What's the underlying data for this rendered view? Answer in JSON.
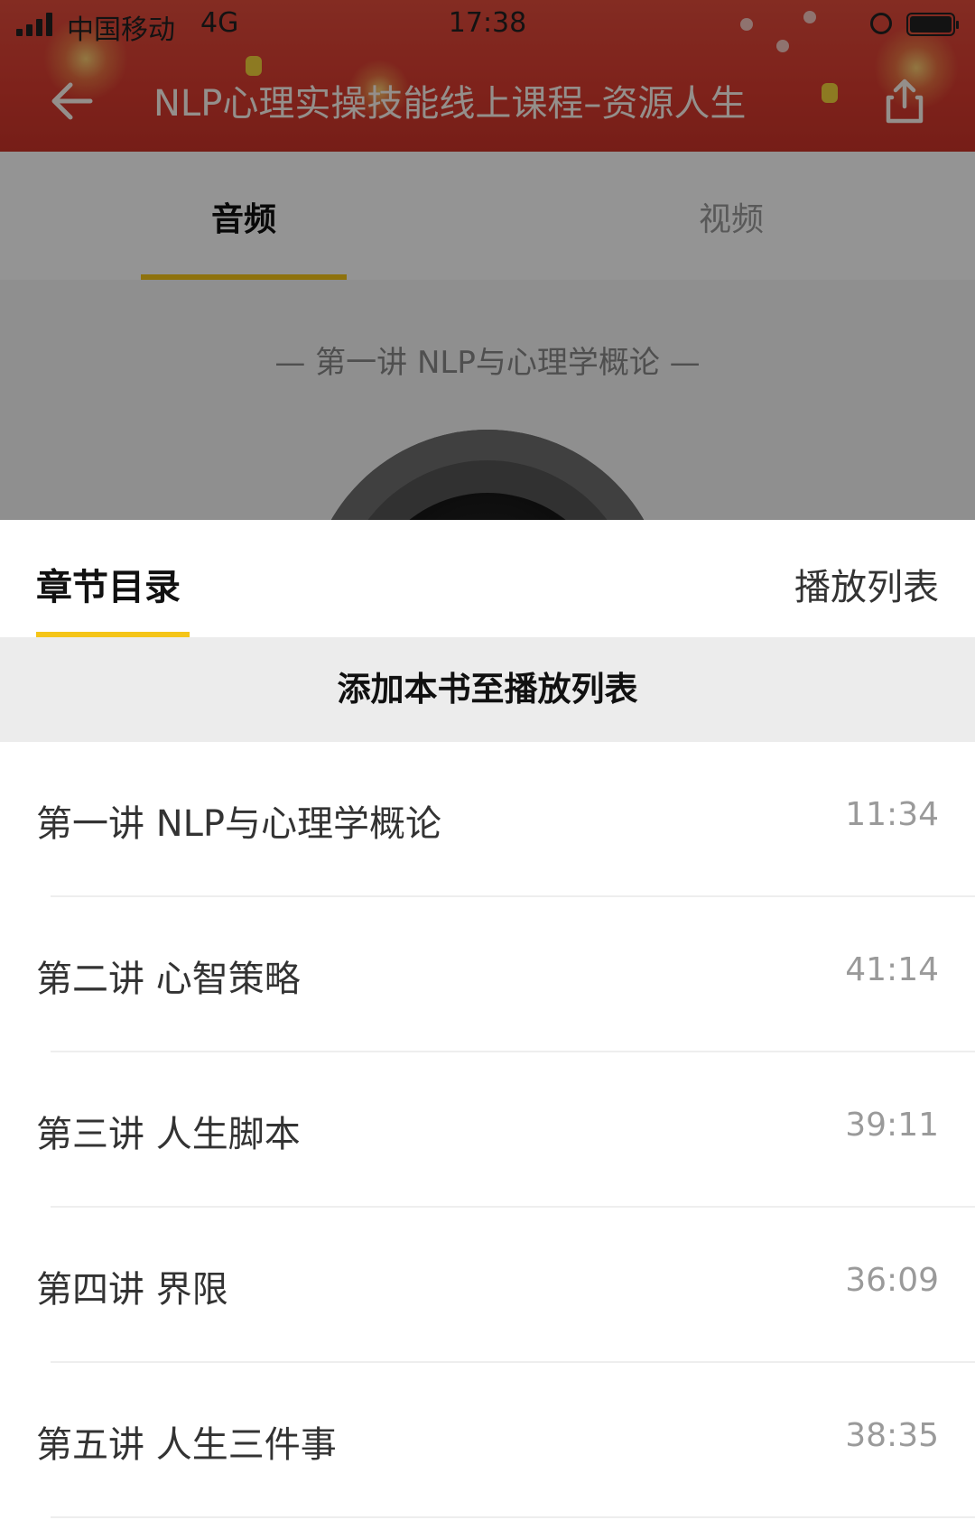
{
  "status_bar": {
    "carrier": "中国移动",
    "network": "4G",
    "time": "17:38"
  },
  "header": {
    "title": "NLP心理实操技能线上课程–资源人生",
    "back_icon": "arrow-left-icon",
    "share_icon": "share-icon"
  },
  "media_tabs": [
    {
      "label": "音频",
      "active": true
    },
    {
      "label": "视频",
      "active": false
    }
  ],
  "now_playing": {
    "chapter_heading": "—   第一讲 NLP与心理学概论   —"
  },
  "sheet": {
    "tabs": [
      {
        "label": "章节目录",
        "active": true
      },
      {
        "label": "播放列表",
        "active": false
      }
    ],
    "add_to_playlist_label": "添加本书至播放列表",
    "chapters": [
      {
        "title": "第一讲 NLP与心理学概论",
        "duration": "11:34"
      },
      {
        "title": "第二讲  心智策略",
        "duration": "41:14"
      },
      {
        "title": "第三讲  人生脚本",
        "duration": "39:11"
      },
      {
        "title": "第四讲  界限",
        "duration": "36:09"
      },
      {
        "title": "第五讲  人生三件事",
        "duration": "38:35"
      }
    ]
  },
  "colors": {
    "accent": "#f5c518",
    "header_red": "#d93b2f"
  }
}
